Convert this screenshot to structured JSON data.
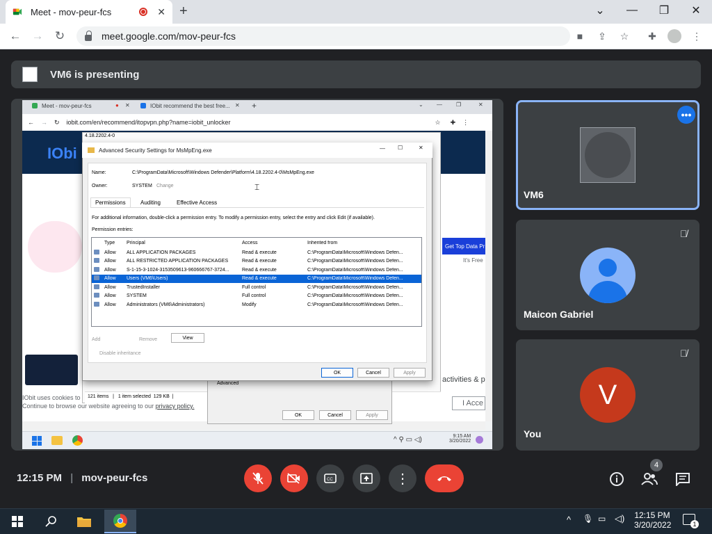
{
  "browser": {
    "tab_title": "Meet - mov-peur-fcs",
    "url": "meet.google.com/mov-peur-fcs",
    "new_tab": "+",
    "win_controls": {
      "dropdown": "⌄",
      "minimize": "—",
      "restore": "❐",
      "close": "✕"
    }
  },
  "banner": {
    "text": "VM6 is presenting"
  },
  "shared_screen": {
    "tab1": "Meet - mov-peur-fcs",
    "tab2": "IObit recommend the best free...",
    "url": "iobit.com/en/recommend/itopvpn.php?name=iobit_unlocker",
    "logo": "IObi",
    "promo": "Get Top Data Pr",
    "promo_sub": "It's Free",
    "cookie1": "IObit uses cookies to",
    "cookie2": "Continue to browse our website agreeing to our",
    "cookie_link": "privacy policy.",
    "accept": "I Acce",
    "activities": "activities & p",
    "explorer_title": "4.18.2202.4-0",
    "explorer_status": "121 items   |   1 item selected  129 KB  |",
    "underlying_advanced": "Advanced",
    "underlying_ok": "OK",
    "underlying_cancel": "Cancel",
    "underlying_apply": "Apply",
    "task_time": "9:15 AM",
    "task_date": "3/20/2022"
  },
  "dialog": {
    "title": "Advanced Security Settings for MsMpEng.exe",
    "name_label": "Name:",
    "name_value": "C:\\ProgramData\\Microsoft\\Windows Defender\\Platform\\4.18.2202.4-0\\MsMpEng.exe",
    "owner_label": "Owner:",
    "owner_value": "SYSTEM",
    "owner_change": "Change",
    "tabs": [
      "Permissions",
      "Auditing",
      "Effective Access"
    ],
    "info": "For additional information, double-click a permission entry. To modify a permission entry, select the entry and click Edit (if available).",
    "entries_label": "Permission entries:",
    "columns": [
      "Type",
      "Principal",
      "Access",
      "Inherited from"
    ],
    "rows": [
      {
        "type": "Allow",
        "principal": "ALL APPLICATION PACKAGES",
        "access": "Read & execute",
        "inherited": "C:\\ProgramData\\Microsoft\\Windows Defen..."
      },
      {
        "type": "Allow",
        "principal": "ALL RESTRICTED APPLICATION PACKAGES",
        "access": "Read & execute",
        "inherited": "C:\\ProgramData\\Microsoft\\Windows Defen..."
      },
      {
        "type": "Allow",
        "principal": "S-1-15-3-1024-3153509613-960666767-3724...",
        "access": "Read & execute",
        "inherited": "C:\\ProgramData\\Microsoft\\Windows Defen..."
      },
      {
        "type": "Allow",
        "principal": "Users (VM6\\Users)",
        "access": "Read & execute",
        "inherited": "C:\\ProgramData\\Microsoft\\Windows Defen..."
      },
      {
        "type": "Allow",
        "principal": "TrustedInstaller",
        "access": "Full control",
        "inherited": "C:\\ProgramData\\Microsoft\\Windows Defen..."
      },
      {
        "type": "Allow",
        "principal": "SYSTEM",
        "access": "Full control",
        "inherited": "C:\\ProgramData\\Microsoft\\Windows Defen..."
      },
      {
        "type": "Allow",
        "principal": "Administrators (VM6\\Administrators)",
        "access": "Modify",
        "inherited": "C:\\ProgramData\\Microsoft\\Windows Defen..."
      }
    ],
    "selected_row": 3,
    "add": "Add",
    "remove": "Remove",
    "view": "View",
    "disable_inheritance": "Disable inheritance",
    "ok": "OK",
    "cancel": "Cancel",
    "apply": "Apply"
  },
  "participants": [
    {
      "name": "VM6",
      "active": true
    },
    {
      "name": "Maicon Gabriel",
      "muted": true
    },
    {
      "name": "You",
      "initial": "V",
      "avatar_color": "#c5391c",
      "muted": true
    }
  ],
  "bottom": {
    "time": "12:15 PM",
    "meeting_code": "mov-peur-fcs",
    "people_count": "4",
    "end_color": "#ea4335"
  },
  "taskbar": {
    "time": "12:15 PM",
    "date": "3/20/2022",
    "notif_count": "1"
  }
}
